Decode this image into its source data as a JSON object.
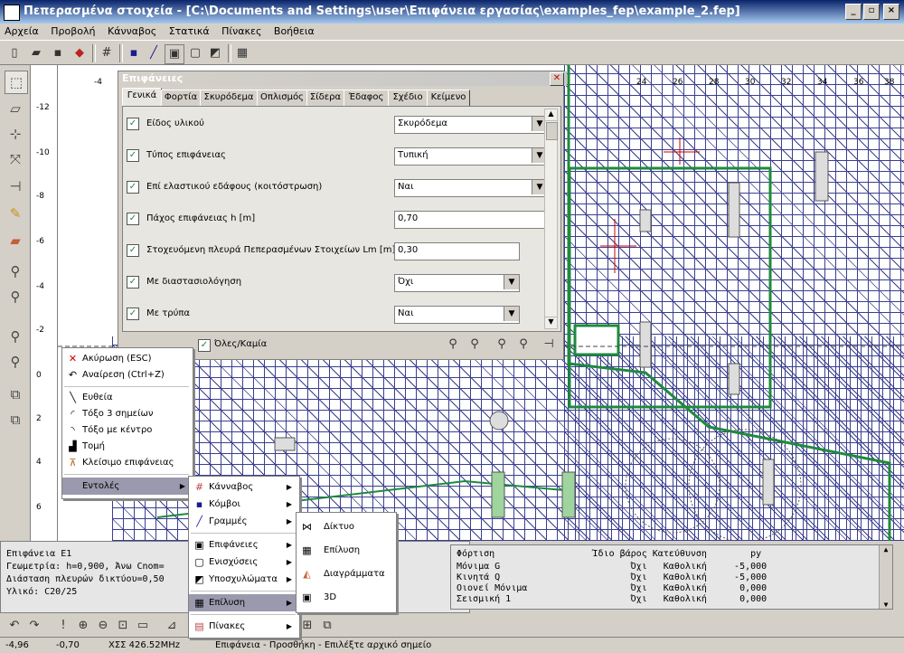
{
  "window": {
    "title": "Πεπερασμένα στοιχεία - [C:\\Documents and Settings\\user\\Επιφάνεια εργασίας\\examples_fep\\example_2.fep]",
    "controls": [
      "_",
      "▫",
      "×"
    ]
  },
  "menubar": [
    "Αρχεία",
    "Προβολή",
    "Κάνναβος",
    "Στατικά",
    "Πίνακες",
    "Βοήθεια"
  ],
  "ruler": {
    "vertical_ticks": [
      "-12",
      "-10",
      "-8",
      "-6",
      "-4",
      "-2",
      "0",
      "2",
      "4",
      "6"
    ],
    "top_ticks": [
      "-4",
      "24",
      "26",
      "28",
      "30",
      "32",
      "34",
      "36",
      "38"
    ]
  },
  "dialog": {
    "title": "Επιφάνειες",
    "tabs": [
      "Γενικά",
      "Φορτία",
      "Σκυρόδεμα",
      "Οπλισμός",
      "Σίδερα",
      "Έδαφος",
      "Σχέδιο",
      "Κείμενο"
    ],
    "rows": [
      {
        "label": "Είδος υλικού",
        "value": "Σκυρόδεμα",
        "dropdown": true
      },
      {
        "label": "Τύπος επιφάνειας",
        "value": "Τυπική",
        "dropdown": true
      },
      {
        "label": "Επί ελαστικού εδάφους (κοιτόστρωση)",
        "value": "Ναι",
        "dropdown": true
      },
      {
        "label": "Πάχος επιφάνειας h [m]",
        "value": "0,70",
        "dropdown": false
      },
      {
        "label": "Στοχευόμενη πλευρά Πεπερασμένων Στοιχείων Lm [m]",
        "value": "0,30",
        "dropdown": false
      },
      {
        "label": "Με διαστασιολόγηση",
        "value": "Όχι",
        "dropdown": true
      },
      {
        "label": "Με τρύπα",
        "value": "Ναι",
        "dropdown": true
      }
    ],
    "all_none_label": "Όλες/Καμία"
  },
  "context_menu": {
    "items": [
      {
        "icon": "cancel-icon",
        "label": "Ακύρωση (ESC)"
      },
      {
        "icon": "undo-icon",
        "label": "Αναίρεση (Ctrl+Z)"
      },
      {
        "icon": "line-icon",
        "label": "Ευθεία"
      },
      {
        "icon": "arc-3pt-icon",
        "label": "Τόξο 3 σημείων"
      },
      {
        "icon": "arc-center-icon",
        "label": "Τόξο με κέντρο"
      },
      {
        "icon": "intersection-icon",
        "label": "Τομή"
      },
      {
        "icon": "close-surface-icon",
        "label": "Κλείσιμο επιφάνειας"
      },
      {
        "icon": "",
        "label": "Εντολές"
      }
    ]
  },
  "submenu_commands": {
    "items": [
      {
        "icon": "grid-icon",
        "label": "Κάνναβος"
      },
      {
        "icon": "node-icon",
        "label": "Κόμβοι"
      },
      {
        "icon": "lines-icon",
        "label": "Γραμμές"
      },
      {
        "icon": "surfaces-icon",
        "label": "Επιφάνειες"
      },
      {
        "icon": "reinforcement-icon",
        "label": "Ενισχύσεις"
      },
      {
        "icon": "subpatterns-icon",
        "label": "Υποσχυλώματα"
      },
      {
        "icon": "solve-icon",
        "label": "Επίλυση"
      },
      {
        "icon": "tables-icon",
        "label": "Πίνακες"
      }
    ]
  },
  "submenu_solve": {
    "items": [
      {
        "icon": "mesh-icon",
        "label": "Δίκτυο"
      },
      {
        "icon": "calc-icon",
        "label": "Επίλυση"
      },
      {
        "icon": "diagrams-icon",
        "label": "Διαγράμματα"
      },
      {
        "icon": "3d-icon",
        "label": "3D"
      }
    ]
  },
  "info_left": [
    "Επιφάνεια Ε1",
    "Γεωμετρία: h=0,900, Άνω Cnom=",
    "Διάσταση πλευρών δικτύου=0,50",
    "Υλικό: C20/25"
  ],
  "info_right": {
    "header": "Φόρτιση                  Ίδιο βάρος Κατεύθυνση        py",
    "rows": [
      "Μόνιμα G                        Όχι   Καθολική     -5,000",
      "Κινητά Q                        Όχι   Καθολική     -5,000",
      "Οιονεί Μόνιμα                   Όχι   Καθολική      0,000",
      "Σεισμική 1                      Όχι   Καθολική      0,000"
    ]
  },
  "status": {
    "x": "-4,96",
    "y": "-0,70",
    "clock": "ΧΣΣ 426.52MHz",
    "message": "Επιφάνεια - Προσθήκη - Επιλέξτε αρχικό σημείο"
  }
}
